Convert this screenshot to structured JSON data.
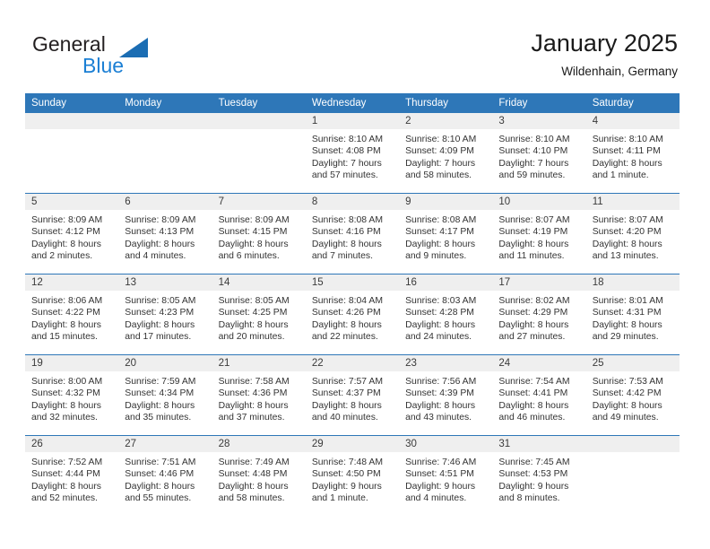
{
  "brand": {
    "line1": "General",
    "line2": "Blue",
    "triangle_color": "#1b6db3"
  },
  "header": {
    "title": "January 2025",
    "subtitle": "Wildenhain, Germany"
  },
  "theme": {
    "header_blue": "#2e77b8",
    "daynum_band": "#efefef",
    "text": "#333333"
  },
  "weekdays": [
    "Sunday",
    "Monday",
    "Tuesday",
    "Wednesday",
    "Thursday",
    "Friday",
    "Saturday"
  ],
  "weeks": [
    [
      {
        "day": "",
        "sunrise": "",
        "sunset": "",
        "daylight1": "",
        "daylight2": "",
        "empty": true
      },
      {
        "day": "",
        "sunrise": "",
        "sunset": "",
        "daylight1": "",
        "daylight2": "",
        "empty": true
      },
      {
        "day": "",
        "sunrise": "",
        "sunset": "",
        "daylight1": "",
        "daylight2": "",
        "empty": true
      },
      {
        "day": "1",
        "sunrise": "Sunrise: 8:10 AM",
        "sunset": "Sunset: 4:08 PM",
        "daylight1": "Daylight: 7 hours",
        "daylight2": "and 57 minutes.",
        "empty": false
      },
      {
        "day": "2",
        "sunrise": "Sunrise: 8:10 AM",
        "sunset": "Sunset: 4:09 PM",
        "daylight1": "Daylight: 7 hours",
        "daylight2": "and 58 minutes.",
        "empty": false
      },
      {
        "day": "3",
        "sunrise": "Sunrise: 8:10 AM",
        "sunset": "Sunset: 4:10 PM",
        "daylight1": "Daylight: 7 hours",
        "daylight2": "and 59 minutes.",
        "empty": false
      },
      {
        "day": "4",
        "sunrise": "Sunrise: 8:10 AM",
        "sunset": "Sunset: 4:11 PM",
        "daylight1": "Daylight: 8 hours",
        "daylight2": "and 1 minute.",
        "empty": false
      }
    ],
    [
      {
        "day": "5",
        "sunrise": "Sunrise: 8:09 AM",
        "sunset": "Sunset: 4:12 PM",
        "daylight1": "Daylight: 8 hours",
        "daylight2": "and 2 minutes.",
        "empty": false
      },
      {
        "day": "6",
        "sunrise": "Sunrise: 8:09 AM",
        "sunset": "Sunset: 4:13 PM",
        "daylight1": "Daylight: 8 hours",
        "daylight2": "and 4 minutes.",
        "empty": false
      },
      {
        "day": "7",
        "sunrise": "Sunrise: 8:09 AM",
        "sunset": "Sunset: 4:15 PM",
        "daylight1": "Daylight: 8 hours",
        "daylight2": "and 6 minutes.",
        "empty": false
      },
      {
        "day": "8",
        "sunrise": "Sunrise: 8:08 AM",
        "sunset": "Sunset: 4:16 PM",
        "daylight1": "Daylight: 8 hours",
        "daylight2": "and 7 minutes.",
        "empty": false
      },
      {
        "day": "9",
        "sunrise": "Sunrise: 8:08 AM",
        "sunset": "Sunset: 4:17 PM",
        "daylight1": "Daylight: 8 hours",
        "daylight2": "and 9 minutes.",
        "empty": false
      },
      {
        "day": "10",
        "sunrise": "Sunrise: 8:07 AM",
        "sunset": "Sunset: 4:19 PM",
        "daylight1": "Daylight: 8 hours",
        "daylight2": "and 11 minutes.",
        "empty": false
      },
      {
        "day": "11",
        "sunrise": "Sunrise: 8:07 AM",
        "sunset": "Sunset: 4:20 PM",
        "daylight1": "Daylight: 8 hours",
        "daylight2": "and 13 minutes.",
        "empty": false
      }
    ],
    [
      {
        "day": "12",
        "sunrise": "Sunrise: 8:06 AM",
        "sunset": "Sunset: 4:22 PM",
        "daylight1": "Daylight: 8 hours",
        "daylight2": "and 15 minutes.",
        "empty": false
      },
      {
        "day": "13",
        "sunrise": "Sunrise: 8:05 AM",
        "sunset": "Sunset: 4:23 PM",
        "daylight1": "Daylight: 8 hours",
        "daylight2": "and 17 minutes.",
        "empty": false
      },
      {
        "day": "14",
        "sunrise": "Sunrise: 8:05 AM",
        "sunset": "Sunset: 4:25 PM",
        "daylight1": "Daylight: 8 hours",
        "daylight2": "and 20 minutes.",
        "empty": false
      },
      {
        "day": "15",
        "sunrise": "Sunrise: 8:04 AM",
        "sunset": "Sunset: 4:26 PM",
        "daylight1": "Daylight: 8 hours",
        "daylight2": "and 22 minutes.",
        "empty": false
      },
      {
        "day": "16",
        "sunrise": "Sunrise: 8:03 AM",
        "sunset": "Sunset: 4:28 PM",
        "daylight1": "Daylight: 8 hours",
        "daylight2": "and 24 minutes.",
        "empty": false
      },
      {
        "day": "17",
        "sunrise": "Sunrise: 8:02 AM",
        "sunset": "Sunset: 4:29 PM",
        "daylight1": "Daylight: 8 hours",
        "daylight2": "and 27 minutes.",
        "empty": false
      },
      {
        "day": "18",
        "sunrise": "Sunrise: 8:01 AM",
        "sunset": "Sunset: 4:31 PM",
        "daylight1": "Daylight: 8 hours",
        "daylight2": "and 29 minutes.",
        "empty": false
      }
    ],
    [
      {
        "day": "19",
        "sunrise": "Sunrise: 8:00 AM",
        "sunset": "Sunset: 4:32 PM",
        "daylight1": "Daylight: 8 hours",
        "daylight2": "and 32 minutes.",
        "empty": false
      },
      {
        "day": "20",
        "sunrise": "Sunrise: 7:59 AM",
        "sunset": "Sunset: 4:34 PM",
        "daylight1": "Daylight: 8 hours",
        "daylight2": "and 35 minutes.",
        "empty": false
      },
      {
        "day": "21",
        "sunrise": "Sunrise: 7:58 AM",
        "sunset": "Sunset: 4:36 PM",
        "daylight1": "Daylight: 8 hours",
        "daylight2": "and 37 minutes.",
        "empty": false
      },
      {
        "day": "22",
        "sunrise": "Sunrise: 7:57 AM",
        "sunset": "Sunset: 4:37 PM",
        "daylight1": "Daylight: 8 hours",
        "daylight2": "and 40 minutes.",
        "empty": false
      },
      {
        "day": "23",
        "sunrise": "Sunrise: 7:56 AM",
        "sunset": "Sunset: 4:39 PM",
        "daylight1": "Daylight: 8 hours",
        "daylight2": "and 43 minutes.",
        "empty": false
      },
      {
        "day": "24",
        "sunrise": "Sunrise: 7:54 AM",
        "sunset": "Sunset: 4:41 PM",
        "daylight1": "Daylight: 8 hours",
        "daylight2": "and 46 minutes.",
        "empty": false
      },
      {
        "day": "25",
        "sunrise": "Sunrise: 7:53 AM",
        "sunset": "Sunset: 4:42 PM",
        "daylight1": "Daylight: 8 hours",
        "daylight2": "and 49 minutes.",
        "empty": false
      }
    ],
    [
      {
        "day": "26",
        "sunrise": "Sunrise: 7:52 AM",
        "sunset": "Sunset: 4:44 PM",
        "daylight1": "Daylight: 8 hours",
        "daylight2": "and 52 minutes.",
        "empty": false
      },
      {
        "day": "27",
        "sunrise": "Sunrise: 7:51 AM",
        "sunset": "Sunset: 4:46 PM",
        "daylight1": "Daylight: 8 hours",
        "daylight2": "and 55 minutes.",
        "empty": false
      },
      {
        "day": "28",
        "sunrise": "Sunrise: 7:49 AM",
        "sunset": "Sunset: 4:48 PM",
        "daylight1": "Daylight: 8 hours",
        "daylight2": "and 58 minutes.",
        "empty": false
      },
      {
        "day": "29",
        "sunrise": "Sunrise: 7:48 AM",
        "sunset": "Sunset: 4:50 PM",
        "daylight1": "Daylight: 9 hours",
        "daylight2": "and 1 minute.",
        "empty": false
      },
      {
        "day": "30",
        "sunrise": "Sunrise: 7:46 AM",
        "sunset": "Sunset: 4:51 PM",
        "daylight1": "Daylight: 9 hours",
        "daylight2": "and 4 minutes.",
        "empty": false
      },
      {
        "day": "31",
        "sunrise": "Sunrise: 7:45 AM",
        "sunset": "Sunset: 4:53 PM",
        "daylight1": "Daylight: 9 hours",
        "daylight2": "and 8 minutes.",
        "empty": false
      },
      {
        "day": "",
        "sunrise": "",
        "sunset": "",
        "daylight1": "",
        "daylight2": "",
        "empty": true
      }
    ]
  ]
}
